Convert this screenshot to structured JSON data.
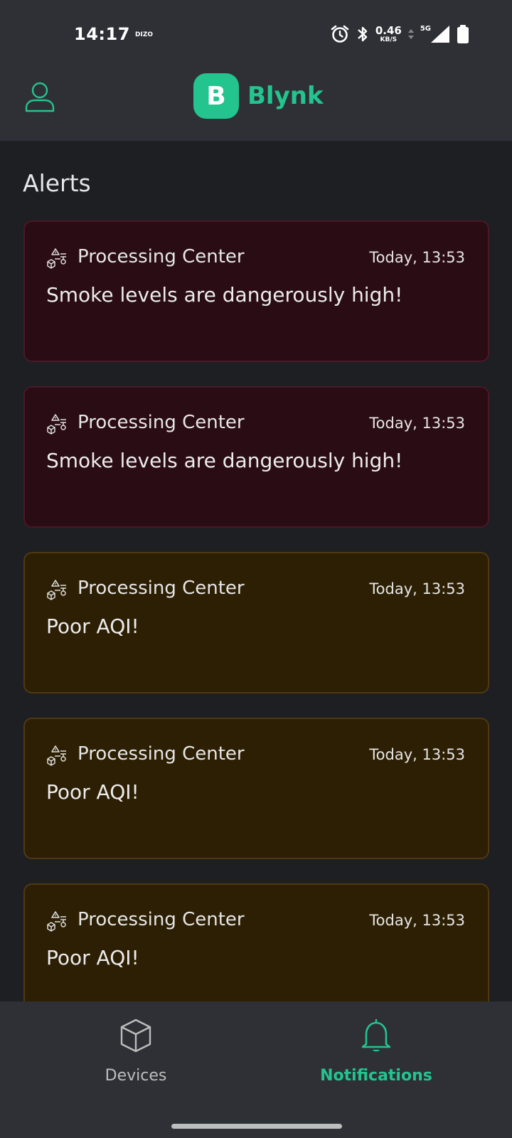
{
  "status_bar": {
    "time": "14:17",
    "carrier": "DIZO",
    "net_speed_value": "0.46",
    "net_speed_unit": "KB/S",
    "net_type": "5G",
    "icons": [
      "alarm-icon",
      "bluetooth-icon",
      "signal-icon",
      "battery-icon"
    ]
  },
  "header": {
    "logo_letter": "B",
    "logo_text": "Blynk",
    "brand_color": "#23c48e"
  },
  "page": {
    "title": "Alerts"
  },
  "alerts": [
    {
      "device": "Processing Center",
      "time": "Today, 13:53",
      "message": "Smoke levels are dangerously high!",
      "severity": "danger"
    },
    {
      "device": "Processing Center",
      "time": "Today, 13:53",
      "message": "Smoke levels are dangerously high!",
      "severity": "danger"
    },
    {
      "device": "Processing Center",
      "time": "Today, 13:53",
      "message": "Poor AQI!",
      "severity": "warning"
    },
    {
      "device": "Processing Center",
      "time": "Today, 13:53",
      "message": "Poor AQI!",
      "severity": "warning"
    },
    {
      "device": "Processing Center",
      "time": "Today, 13:53",
      "message": "Poor AQI!",
      "severity": "warning"
    }
  ],
  "colors": {
    "danger_bg": "#2a0c15",
    "warning_bg": "#2d1f03",
    "active_nav": "#23c48e"
  },
  "bottom_nav": {
    "devices_label": "Devices",
    "notifications_label": "Notifications",
    "active": "notifications"
  }
}
